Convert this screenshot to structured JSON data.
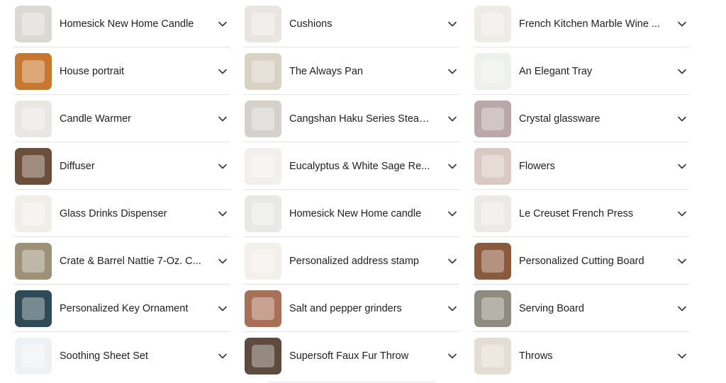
{
  "columns": [
    {
      "items": [
        {
          "label": "Homesick New Home Candle",
          "thumb_icon": "candle-jar-image",
          "thumb_color": "#dcd8d3"
        },
        {
          "label": "House portrait",
          "thumb_icon": "house-portrait-image",
          "thumb_color": "#c8782e"
        },
        {
          "label": "Candle Warmer",
          "thumb_icon": "candle-warmer-image",
          "thumb_color": "#e9e7e4"
        },
        {
          "label": "Diffuser",
          "thumb_icon": "diffuser-image",
          "thumb_color": "#6c4f3a"
        },
        {
          "label": "Glass Drinks Dispenser",
          "thumb_icon": "drinks-dispenser-image",
          "thumb_color": "#f1eeea"
        },
        {
          "label": "Crate & Barrel Nattie 7-Oz. C...",
          "thumb_icon": "plant-vase-image",
          "thumb_color": "#9d9178"
        },
        {
          "label": "Personalized Key Ornament",
          "thumb_icon": "key-ornament-image",
          "thumb_color": "#2f4a57"
        },
        {
          "label": "Soothing Sheet Set",
          "thumb_icon": "sheet-set-image",
          "thumb_color": "#eef1f4"
        }
      ]
    },
    {
      "items": [
        {
          "label": "Cushions",
          "thumb_icon": "cushion-image",
          "thumb_color": "#e9e6e2"
        },
        {
          "label": "The Always Pan",
          "thumb_icon": "pan-image",
          "thumb_color": "#d9d2c4"
        },
        {
          "label": "Cangshan Haku Series Steak...",
          "thumb_icon": "steak-knives-image",
          "thumb_color": "#d4d1cc"
        },
        {
          "label": "Eucalyptus & White Sage Re...",
          "thumb_icon": "reed-diffuser-image",
          "thumb_color": "#f2f0ec"
        },
        {
          "label": "Homesick New Home candle",
          "thumb_icon": "candle-jar-image",
          "thumb_color": "#e8e8e6"
        },
        {
          "label": "Personalized address stamp",
          "thumb_icon": "address-stamp-image",
          "thumb_color": "#f3efea"
        },
        {
          "label": "Salt and pepper grinders",
          "thumb_icon": "grinders-image",
          "thumb_color": "#a97058"
        },
        {
          "label": "Supersoft Faux Fur Throw",
          "thumb_icon": "fur-throw-image",
          "thumb_color": "#5e4a3e"
        }
      ]
    },
    {
      "items": [
        {
          "label": "French Kitchen Marble Wine ...",
          "thumb_icon": "wine-chiller-image",
          "thumb_color": "#efece7"
        },
        {
          "label": "An Elegant Tray",
          "thumb_icon": "tray-image",
          "thumb_color": "#eef0ec"
        },
        {
          "label": "Crystal glassware",
          "thumb_icon": "glassware-image",
          "thumb_color": "#b9a7a9"
        },
        {
          "label": "Flowers",
          "thumb_icon": "flowers-image",
          "thumb_color": "#d9c9c2"
        },
        {
          "label": "Le Creuset French Press",
          "thumb_icon": "french-press-image",
          "thumb_color": "#ebeae7"
        },
        {
          "label": "Personalized Cutting Board",
          "thumb_icon": "cutting-board-image",
          "thumb_color": "#8a5a3c"
        },
        {
          "label": "Serving Board",
          "thumb_icon": "serving-board-image",
          "thumb_color": "#8f8b7e"
        },
        {
          "label": "Throws",
          "thumb_icon": "throw-blanket-image",
          "thumb_color": "#e3ddd3"
        }
      ]
    }
  ],
  "chevron_icon": "chevron-down-icon"
}
